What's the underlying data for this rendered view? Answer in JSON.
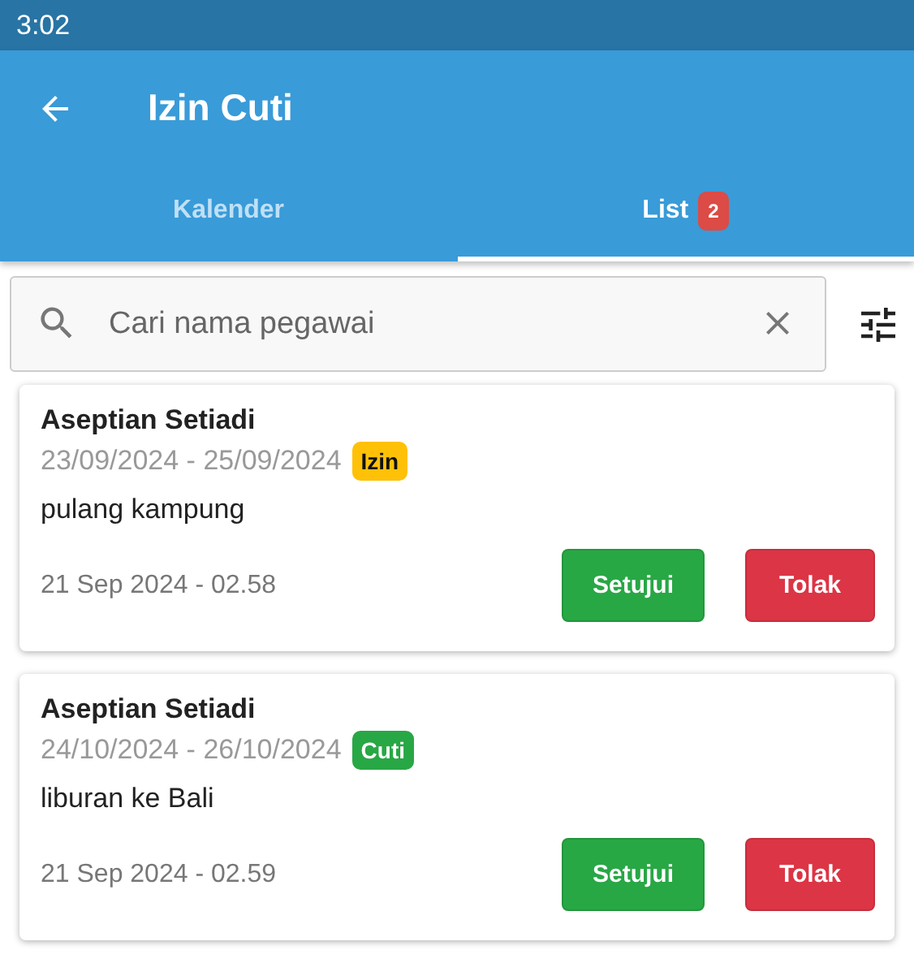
{
  "status_bar": {
    "time": "3:02"
  },
  "app_bar": {
    "title": "Izin Cuti"
  },
  "tabs": [
    {
      "label": "Kalender",
      "selected": false
    },
    {
      "label": "List",
      "selected": true,
      "badge": "2"
    }
  ],
  "search": {
    "placeholder": "Cari nama pegawai"
  },
  "requests": [
    {
      "name": "Aseptian Setiadi",
      "dates": "23/09/2024 - 25/09/2024",
      "tag": {
        "label": "Izin",
        "color": "#ffc107"
      },
      "reason": "pulang kampung",
      "submitted": "21 Sep 2024 - 02.58",
      "approve": "Setujui",
      "reject": "Tolak"
    },
    {
      "name": "Aseptian Setiadi",
      "dates": "24/10/2024 - 26/10/2024",
      "tag": {
        "label": "Cuti",
        "color": "#28a745"
      },
      "reason": "liburan ke Bali",
      "submitted": "21 Sep 2024 - 02.59",
      "approve": "Setujui",
      "reject": "Tolak"
    }
  ]
}
